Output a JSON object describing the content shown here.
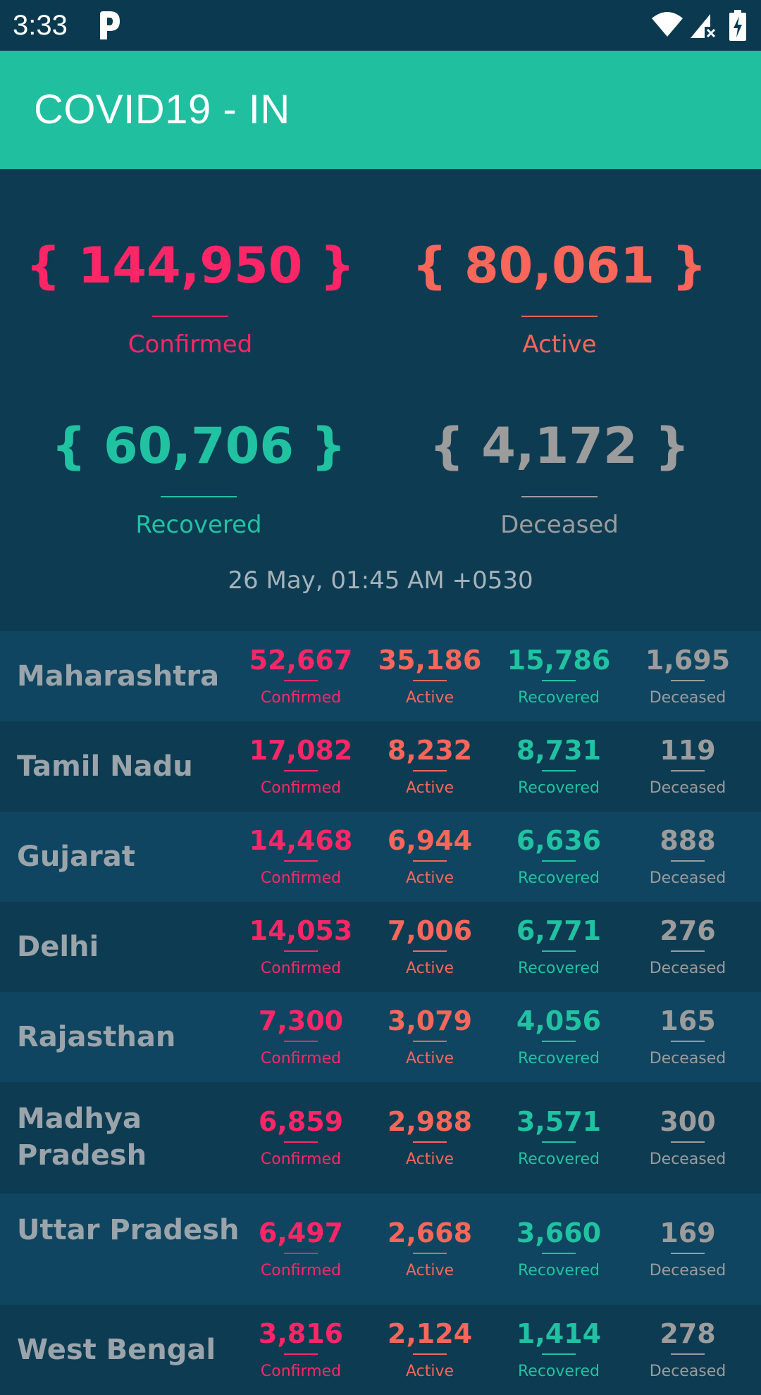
{
  "status_bar": {
    "time": "3:33",
    "icons": [
      "parking-app-icon",
      "wifi-icon",
      "cell-signal-icon",
      "battery-charging-icon"
    ]
  },
  "app_bar": {
    "title": "COVID19 - IN"
  },
  "colors": {
    "confirmed": "#ff2667",
    "active": "#f9665a",
    "recovered": "#21c2a1",
    "deceased": "#9c9c9c",
    "accent": "#20bfa0",
    "background": "#0d3b52"
  },
  "summary": {
    "confirmed": {
      "value": "{ 144,950 }",
      "label": "Confirmed"
    },
    "active": {
      "value": "{ 80,061 }",
      "label": "Active"
    },
    "recovered": {
      "value": "{ 60,706 }",
      "label": "Recovered"
    },
    "deceased": {
      "value": "{ 4,172 }",
      "label": "Deceased"
    },
    "updated": "26 May, 01:45 AM +0530"
  },
  "labels": {
    "confirmed": "Confirmed",
    "active": "Active",
    "recovered": "Recovered",
    "deceased": "Deceased"
  },
  "states": [
    {
      "name": "Maharashtra",
      "confirmed": "52,667",
      "active": "35,186",
      "recovered": "15,786",
      "deceased": "1,695"
    },
    {
      "name": "Tamil Nadu",
      "confirmed": "17,082",
      "active": "8,232",
      "recovered": "8,731",
      "deceased": "119"
    },
    {
      "name": "Gujarat",
      "confirmed": "14,468",
      "active": "6,944",
      "recovered": "6,636",
      "deceased": "888"
    },
    {
      "name": "Delhi",
      "confirmed": "14,053",
      "active": "7,006",
      "recovered": "6,771",
      "deceased": "276"
    },
    {
      "name": "Rajasthan",
      "confirmed": "7,300",
      "active": "3,079",
      "recovered": "4,056",
      "deceased": "165"
    },
    {
      "name": "Madhya Pradesh",
      "confirmed": "6,859",
      "active": "2,988",
      "recovered": "3,571",
      "deceased": "300"
    },
    {
      "name": "Uttar Pradesh",
      "confirmed": "6,497",
      "active": "2,668",
      "recovered": "3,660",
      "deceased": "169"
    },
    {
      "name": "West Bengal",
      "confirmed": "3,816",
      "active": "2,124",
      "recovered": "1,414",
      "deceased": "278"
    }
  ]
}
